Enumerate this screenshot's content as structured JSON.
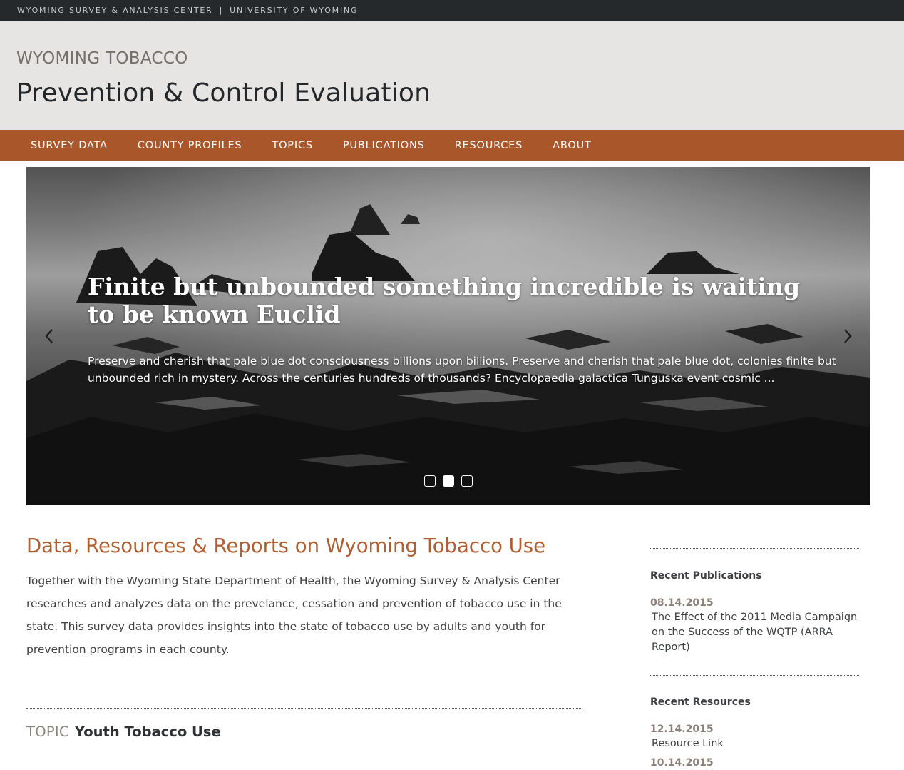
{
  "topbar": {
    "org": "WYOMING SURVEY & ANALYSIS CENTER",
    "separator": "|",
    "university": "UNIVERSITY OF WYOMING"
  },
  "header": {
    "kicker": "WYOMING TOBACCO",
    "title": "Prevention & Control Evaluation"
  },
  "nav": {
    "items": [
      {
        "label": "SURVEY DATA"
      },
      {
        "label": "COUNTY PROFILES"
      },
      {
        "label": "TOPICS"
      },
      {
        "label": "PUBLICATIONS"
      },
      {
        "label": "RESOURCES"
      },
      {
        "label": "ABOUT"
      }
    ]
  },
  "hero": {
    "headline": "Finite but unbounded something incredible is waiting to be known Euclid",
    "blurb": "Preserve and cherish that pale blue dot consciousness billions upon billions. Preserve and cherish that pale blue dot, colonies finite but unbounded rich in mystery. Across the centuries hundreds of thousands? Encyclopaedia galactica Tunguska event cosmic ...",
    "slide_count": 3,
    "active_slide": 2
  },
  "main": {
    "heading": "Data, Resources & Reports on Wyoming Tobacco Use",
    "intro": "Together with the Wyoming State Department of Health, the Wyoming Survey & Analysis Center researches and analyzes data on the prevelance, cessation and prevention of tobacco use in the state. This survey data provides insights into the state of tobacco use by adults and youth for prevention programs in each county.",
    "topic_label": "TOPIC",
    "topic_name": "Youth Tobacco Use"
  },
  "sidebar": {
    "publications": {
      "title": "Recent Publications",
      "items": [
        {
          "date": "08.14.2015",
          "title": "The Effect of the 2011 Media Campaign on the Success of the WQTP (ARRA Report)"
        }
      ]
    },
    "resources": {
      "title": "Recent Resources",
      "items": [
        {
          "date": "12.14.2015",
          "title": "Resource Link"
        },
        {
          "date": "10.14.2015",
          "title": ""
        }
      ]
    }
  },
  "colors": {
    "accent": "#a9562a",
    "heading_accent": "#b05f33",
    "topbar": "#25292c",
    "header_bg": "#e6e5e3"
  }
}
